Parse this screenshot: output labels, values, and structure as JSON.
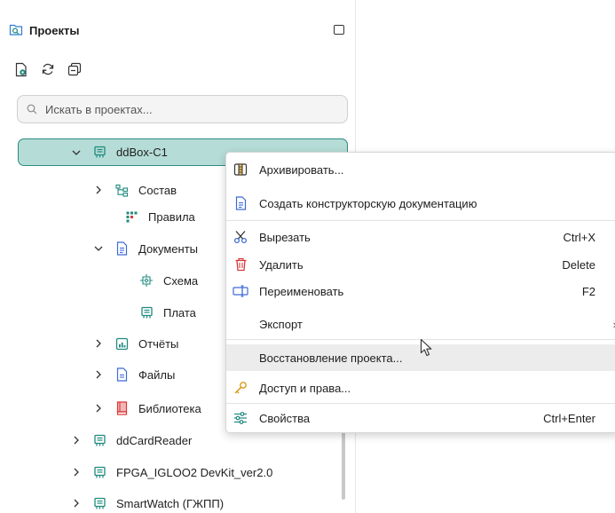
{
  "panel": {
    "title": "Проекты",
    "search_placeholder": "Искать в проектах..."
  },
  "tree": [
    {
      "label": "ddBox-C1",
      "icon": "board-icon",
      "expanded": true,
      "selected": true
    },
    {
      "label": "Состав",
      "icon": "hierarchy-icon",
      "expanded": false
    },
    {
      "label": "Правила",
      "icon": "rules-grid-icon"
    },
    {
      "label": "Документы",
      "icon": "document-icon",
      "expanded": true
    },
    {
      "label": "Схема",
      "icon": "schematic-icon"
    },
    {
      "label": "Плата",
      "icon": "board-icon"
    },
    {
      "label": "Отчёты",
      "icon": "report-icon",
      "expanded": false
    },
    {
      "label": "Файлы",
      "icon": "file-icon",
      "expanded": false
    },
    {
      "label": "Библиотека",
      "icon": "library-icon",
      "expanded": false
    },
    {
      "label": "ddCardReader",
      "icon": "board-icon",
      "expanded": false
    },
    {
      "label": "FPGA_IGLOO2 DevKit_ver2.0",
      "icon": "board-icon",
      "expanded": false
    },
    {
      "label": "SmartWatch (ГЖПП)",
      "icon": "board-icon",
      "expanded": false
    }
  ],
  "context_menu": {
    "items": [
      {
        "label": "Архивировать...",
        "icon": "archive-icon",
        "shortcut": ""
      },
      {
        "label": "Создать конструкторскую документацию",
        "icon": "document-icon",
        "shortcut": ""
      },
      {
        "label": "Вырезать",
        "icon": "scissors-icon",
        "shortcut": "Ctrl+X"
      },
      {
        "label": "Удалить",
        "icon": "trash-icon",
        "shortcut": "Delete"
      },
      {
        "label": "Переименовать",
        "icon": "rename-icon",
        "shortcut": "F2"
      },
      {
        "label": "Экспорт",
        "icon": "",
        "shortcut": "",
        "submenu_arrow": "›"
      },
      {
        "label": "Восстановление проекта...",
        "icon": "",
        "shortcut": ""
      },
      {
        "label": "Доступ и права...",
        "icon": "key-icon",
        "shortcut": ""
      },
      {
        "label": "Свойства",
        "icon": "sliders-icon",
        "shortcut": "Ctrl+Enter"
      }
    ]
  },
  "colors": {
    "selection_fill": "#b5dcd6",
    "selection_border": "#2d8c82",
    "icon_teal": "#1f8a7e",
    "icon_blue": "#3d6bd8",
    "icon_red": "#d9383a"
  }
}
